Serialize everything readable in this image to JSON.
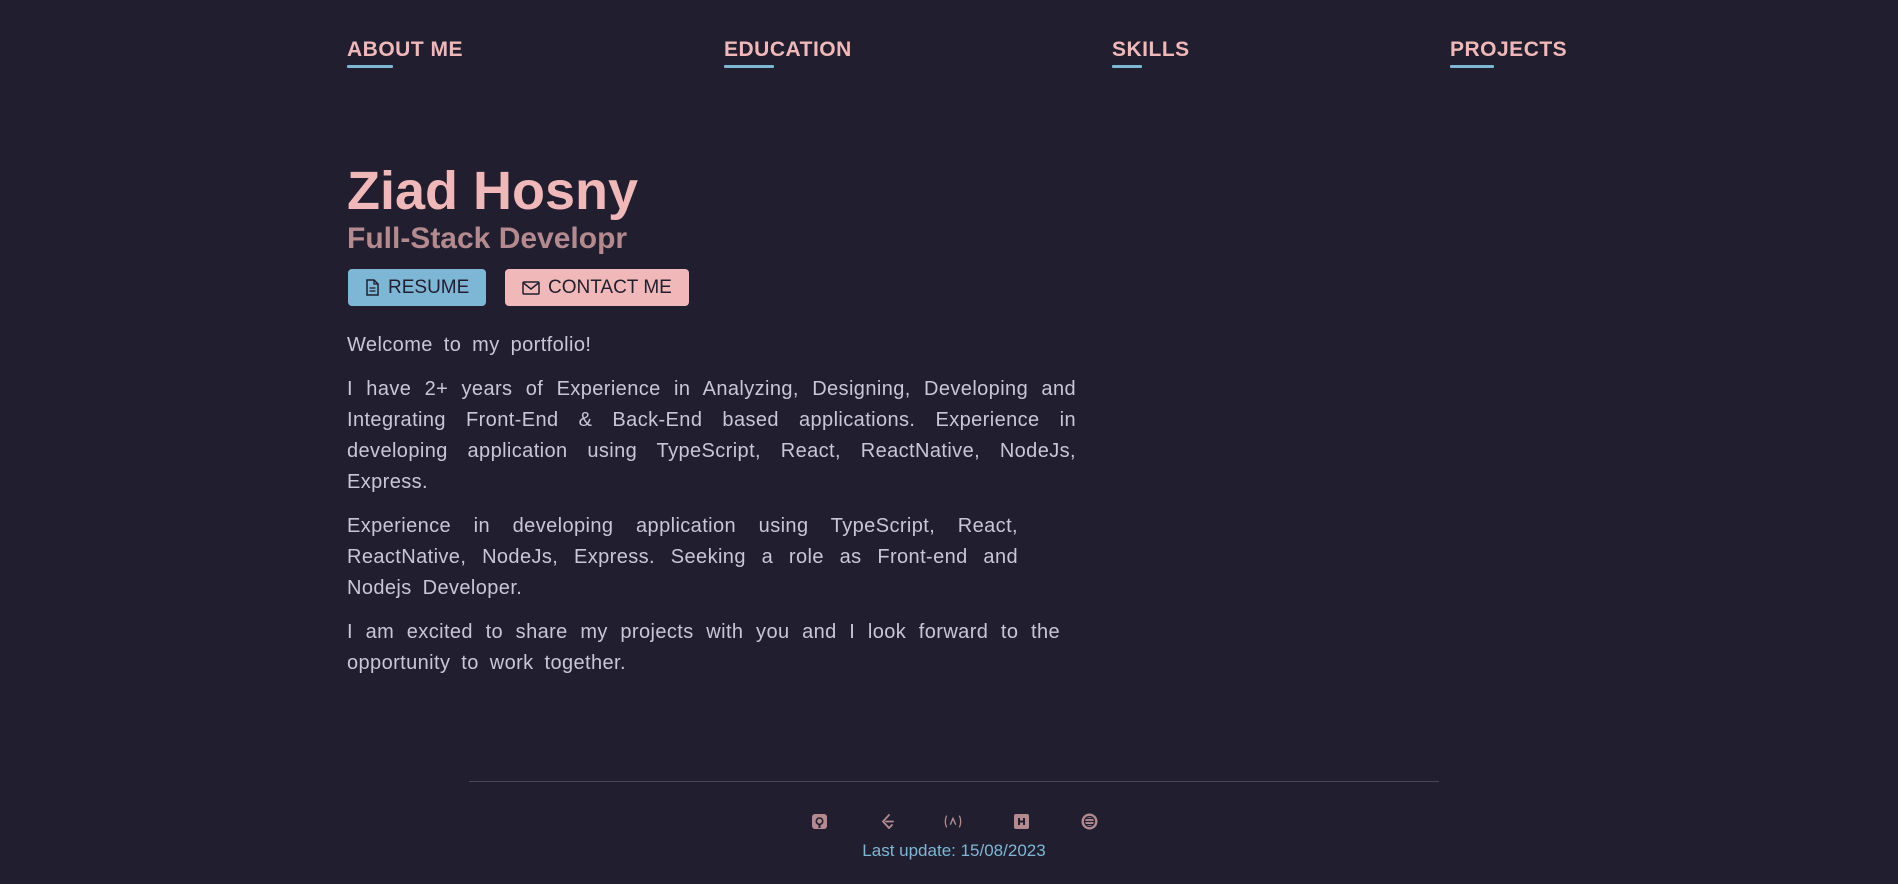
{
  "nav": {
    "about": "ABOUT ME",
    "education": "EDUCATION",
    "skills": "SKILLS",
    "projects": "PROJECTS"
  },
  "hero": {
    "name": "Ziad Hosny",
    "role": "Full-Stack Developr",
    "resume_label": "RESUME",
    "contact_label": "CONTACT ME"
  },
  "intro": {
    "p1": "Welcome to my portfolio!",
    "p2": "I have 2+ years of Experience in Analyzing, Designing, Developing and Integrating Front-End & Back-End based applications. Experience in developing application using TypeScript, React, ReactNative, NodeJs, Express.",
    "p3": "Experience in developing application using TypeScript, React, ReactNative, NodeJs, Express. Seeking a role as Front-end and Nodejs Developer.",
    "p4": "I am excited to share my projects with you and I look forward to the opportunity to work together."
  },
  "footer": {
    "social_icons": [
      "github-icon",
      "leetcode-icon",
      "freecodecamp-icon",
      "hackerrank-icon",
      "codewars-icon"
    ],
    "last_update": "Last update: 15/08/2023"
  },
  "colors": {
    "background": "#211f2f",
    "pink": "#f0b8b8",
    "blue": "#7eb7d6",
    "muted_pink": "#b48a8f",
    "text": "#c9c6d6"
  }
}
